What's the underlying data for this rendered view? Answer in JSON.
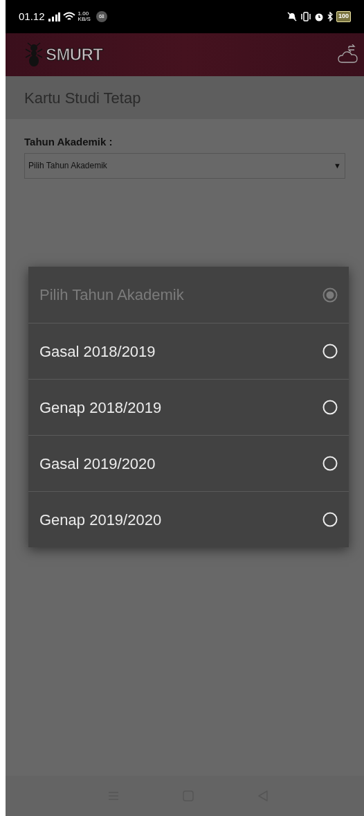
{
  "status_bar": {
    "time": "01.12",
    "speed_value": "1.00",
    "speed_unit": "KB/S",
    "notification_count": "68",
    "battery": "100"
  },
  "app_bar": {
    "logo_text": "SMURT"
  },
  "page_title": "Kartu Studi Tetap",
  "form": {
    "label": "Tahun Akademik :",
    "select_value": "Pilih Tahun Akademik",
    "select_arrow": "▼"
  },
  "dialog": {
    "options": [
      {
        "label": "Pilih Tahun Akademik",
        "selected": true,
        "disabled": true
      },
      {
        "label": "Gasal 2018/2019",
        "selected": false,
        "disabled": false
      },
      {
        "label": "Genap 2018/2019",
        "selected": false,
        "disabled": false
      },
      {
        "label": "Gasal 2019/2020",
        "selected": false,
        "disabled": false
      },
      {
        "label": "Genap 2019/2020",
        "selected": false,
        "disabled": false
      }
    ]
  }
}
